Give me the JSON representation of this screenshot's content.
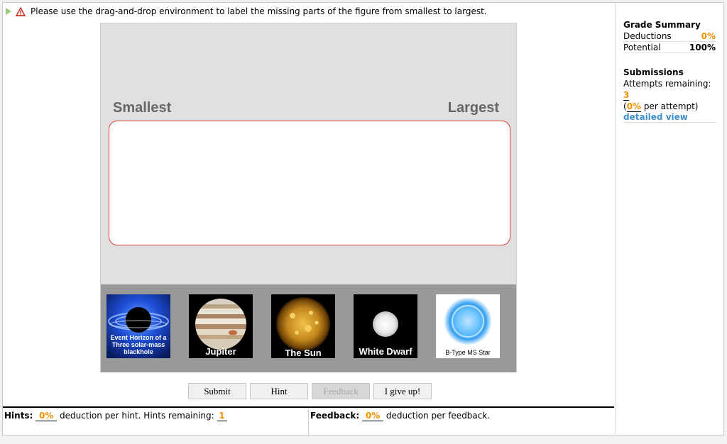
{
  "question": {
    "instructions": "Please use the drag-and-drop environment to label the missing parts of the figure from smallest to largest."
  },
  "stage": {
    "label_smallest": "Smallest",
    "label_largest": "Largest"
  },
  "cards": [
    {
      "name": "event-horizon-card",
      "label": "Event Horizon of a Three solar-mass blackhole"
    },
    {
      "name": "jupiter-card",
      "label": "Jupiter"
    },
    {
      "name": "sun-card",
      "label": "The Sun"
    },
    {
      "name": "white-dwarf-card",
      "label": "White Dwarf"
    },
    {
      "name": "b-type-star-card",
      "label": "B-Type MS Star"
    }
  ],
  "buttons": {
    "submit": "Submit",
    "hint": "Hint",
    "feedback": "Feedback",
    "give_up": "I give up!"
  },
  "hints": {
    "label": "Hints:",
    "deduction": "0%",
    "text": "deduction per hint. Hints remaining:",
    "remaining": "1"
  },
  "feedback": {
    "label": "Feedback:",
    "deduction": "0%",
    "text": "deduction per feedback."
  },
  "grade_summary": {
    "title": "Grade Summary",
    "deductions_label": "Deductions",
    "deductions_value": "0%",
    "potential_label": "Potential",
    "potential_value": "100%"
  },
  "submissions": {
    "title": "Submissions",
    "attempts_label": "Attempts remaining:",
    "attempts_value": "3",
    "per_attempt_value": "0%",
    "per_attempt_text": "per attempt)",
    "detailed_view": "detailed view"
  },
  "colors": {
    "accent_orange": "#f39200",
    "link_blue": "#3f8ecb",
    "dropzone_border": "#e03a3a"
  }
}
